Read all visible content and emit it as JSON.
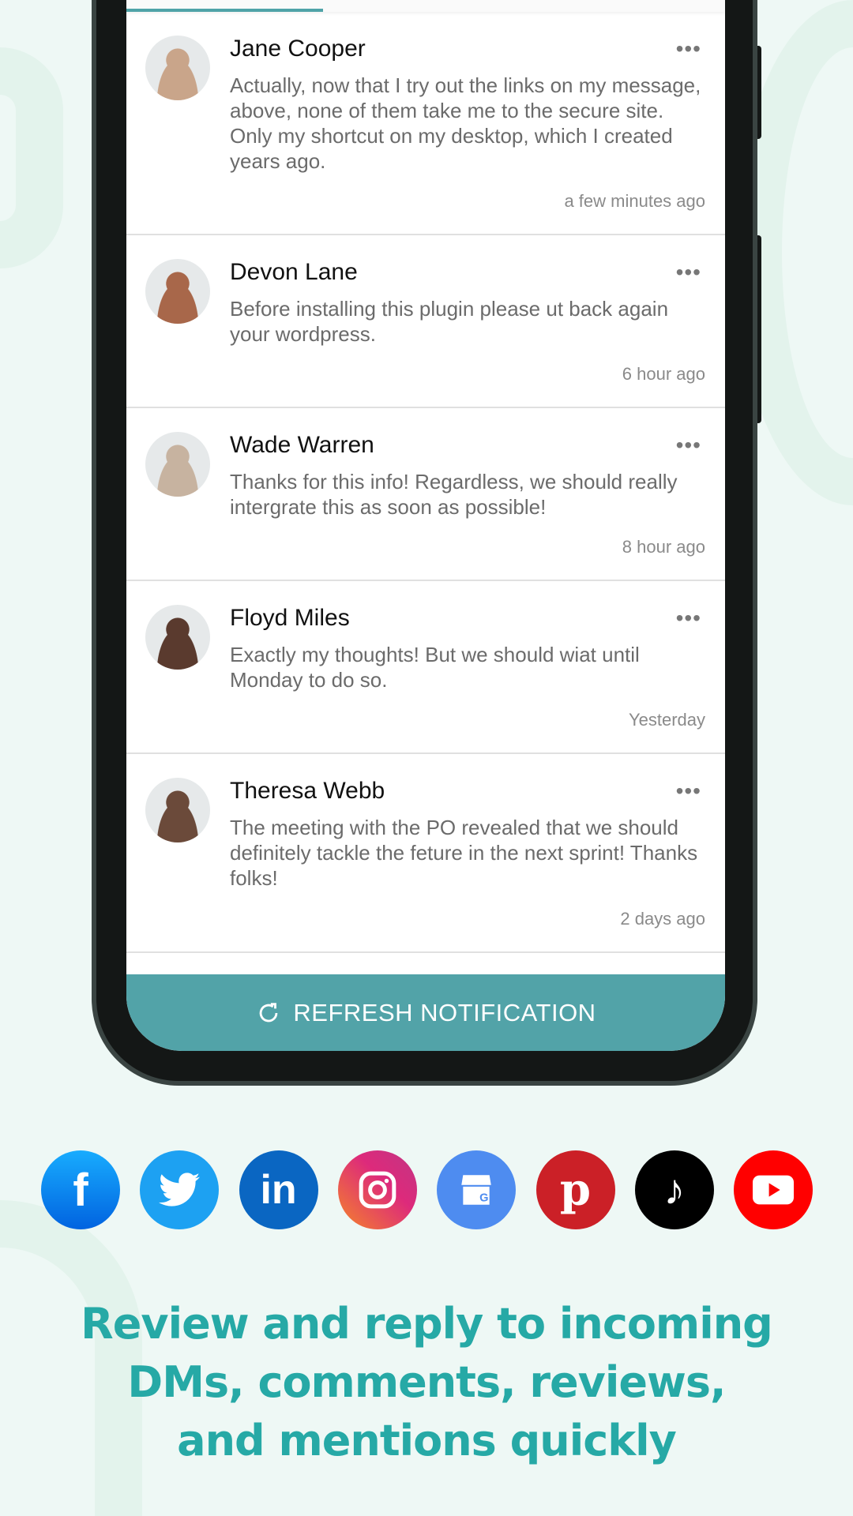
{
  "notifications": [
    {
      "name": "Jane Cooper",
      "message": "Actually, now that I try out the links on my message, above, none of them take me to the secure site. Only my shortcut on my desktop, which I created years ago.",
      "time": "a few minutes ago",
      "avatar_color": "#c9a58a"
    },
    {
      "name": "Devon Lane",
      "message": "Before installing this plugin please ut back again your wordpress.",
      "time": "6 hour ago",
      "avatar_color": "#a8674a"
    },
    {
      "name": "Wade Warren",
      "message": "Thanks for this info! Regardless, we should really intergrate this as soon as possible!",
      "time": "8 hour ago",
      "avatar_color": "#c7b3a0"
    },
    {
      "name": "Floyd Miles",
      "message": "Exactly my thoughts! But we should wiat until Monday to do so.",
      "time": "Yesterday",
      "avatar_color": "#5a3a2e"
    },
    {
      "name": "Theresa Webb",
      "message": "The meeting with the PO revealed that we should definitely tackle the feture in the next sprint! Thanks folks!",
      "time": "2 days ago",
      "avatar_color": "#6b4a3a"
    }
  ],
  "refresh_button": {
    "label": "REFRESH NOTIFICATION",
    "icon": "refresh-icon"
  },
  "social_icons": [
    {
      "name": "facebook",
      "color": "#1877f2"
    },
    {
      "name": "twitter",
      "color": "#1da1f2"
    },
    {
      "name": "linkedin",
      "color": "#0a66c2"
    },
    {
      "name": "instagram",
      "color": "#e1306c"
    },
    {
      "name": "google-business",
      "color": "#4e8cf0"
    },
    {
      "name": "pinterest",
      "color": "#cb2027"
    },
    {
      "name": "tiktok",
      "color": "#000000"
    },
    {
      "name": "youtube",
      "color": "#ff0000"
    }
  ],
  "headline": [
    "Review and reply to incoming",
    "DMs, comments, reviews,",
    "and mentions quickly"
  ],
  "colors": {
    "accent": "#52a3a8",
    "headline": "#26a9a6",
    "background": "#eef8f5"
  }
}
